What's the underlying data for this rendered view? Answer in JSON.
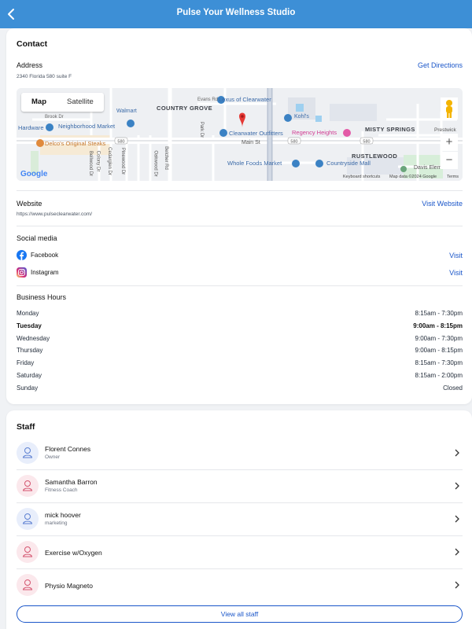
{
  "header": {
    "title": "Pulse Your Wellness Studio"
  },
  "contact": {
    "section_title": "Contact",
    "address_label": "Address",
    "address": "2340 Florida 580 suite F",
    "directions_link": "Get Directions",
    "map": {
      "toggle_map": "Map",
      "toggle_satellite": "Satellite",
      "labels": {
        "lexus": "Lexus of Clearwater",
        "walmart": "Walmart",
        "neighborhood_market": "Neighborhood Market",
        "country_grove": "COUNTRY GROVE",
        "kohls": "Kohl's",
        "regency": "Regency Heights",
        "misty": "MISTY SPRINGS",
        "clearwater_outfitters": "Clearwater Outfitters",
        "main_st": "Main St",
        "hardware": "Hardware",
        "steaks": "Delco's Original Steaks",
        "brook": "Brook Dr",
        "evans": "Evans Rd",
        "rustlewood": "RUSTLEWOOD",
        "whole_foods": "Whole Foods Market",
        "countryside_mall": "Countryside Mall",
        "davis": "Davis Elementar",
        "belcher": "Belcher Rd",
        "park_dr": "Park Dr",
        "oakwood": "Oakwood Dr",
        "pinewood": "Pinewood Dr",
        "cedarglen": "Cedarglen Dr",
        "colony": "Colony Dr",
        "bellwood": "Bellwood Dr",
        "prestwick": "Prestwick",
        "badge_580": "580",
        "google": "Google",
        "keyboard": "Keyboard shortcuts",
        "map_data": "Map data ©2024 Google",
        "terms": "Terms"
      }
    },
    "website_label": "Website",
    "website_url": "https://www.pulseclearwater.com/",
    "website_link": "Visit Website",
    "social_label": "Social media",
    "social": [
      {
        "name": "Facebook",
        "link": "Visit"
      },
      {
        "name": "Instagram",
        "link": "Visit"
      }
    ],
    "hours_label": "Business Hours",
    "hours": [
      {
        "day": "Monday",
        "time": "8:15am - 7:30pm"
      },
      {
        "day": "Tuesday",
        "time": "9:00am - 8:15pm"
      },
      {
        "day": "Wednesday",
        "time": "9:00am - 7:30pm"
      },
      {
        "day": "Thursday",
        "time": "9:00am - 8:15pm"
      },
      {
        "day": "Friday",
        "time": "8:15am - 7:30pm"
      },
      {
        "day": "Saturday",
        "time": "8:15am - 2:00pm"
      },
      {
        "day": "Sunday",
        "time": "Closed"
      }
    ]
  },
  "staff": {
    "section_title": "Staff",
    "members": [
      {
        "name": "Florent Connes",
        "role": "Owner"
      },
      {
        "name": "Samantha Barron",
        "role": "Fitness Coach"
      },
      {
        "name": "mick hoover",
        "role": "marketing"
      },
      {
        "name": "Exercise w/Oxygen",
        "role": ""
      },
      {
        "name": "Physio Magneto",
        "role": ""
      }
    ],
    "view_all": "View all staff"
  },
  "colors": {
    "header": "#3d8fd6",
    "link": "#1a56c9",
    "avatar_blue": "#e8eefb",
    "avatar_pink": "#fbe8ec"
  }
}
